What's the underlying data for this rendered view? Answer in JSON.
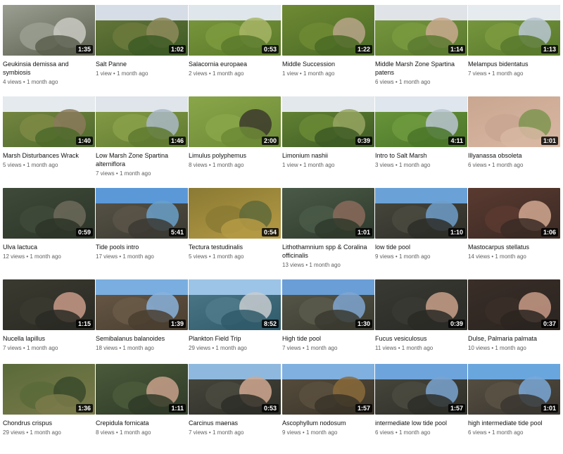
{
  "videos": [
    {
      "title": "Geukinsia demissa and symbiosis",
      "duration": "1:35",
      "views": "4 views",
      "age": "1 month ago",
      "colors": [
        "#9a9f92",
        "#c9c9c2",
        "#5b5f4e"
      ],
      "sky": null
    },
    {
      "title": "Salt Panne",
      "duration": "1:02",
      "views": "1 view",
      "age": "1 month ago",
      "colors": [
        "#6c7a3c",
        "#8d8a5c",
        "#3d5a26"
      ],
      "sky": "#d6dde6"
    },
    {
      "title": "Salacornia europaea",
      "duration": "0:53",
      "views": "2 views",
      "age": "1 month ago",
      "colors": [
        "#7d9a3e",
        "#a7b566",
        "#5b7a2b"
      ],
      "sky": "#dfe6ec"
    },
    {
      "title": "Middle Succession",
      "duration": "1:22",
      "views": "1 view",
      "age": "1 month ago",
      "colors": [
        "#6f8a34",
        "#b7a58a",
        "#4a6a25"
      ],
      "sky": null
    },
    {
      "title": "Middle Marsh Zone Spartina patens",
      "duration": "1:14",
      "views": "6 views",
      "age": "1 month ago",
      "colors": [
        "#7a9a3f",
        "#c9a98e",
        "#5b7a30"
      ],
      "sky": "#e0e4e9"
    },
    {
      "title": "Melampus bidentatus",
      "duration": "1:13",
      "views": "7 views",
      "age": "1 month ago",
      "colors": [
        "#7c9b40",
        "#b8c7d3",
        "#59792d"
      ],
      "sky": "#e6ebf0"
    },
    {
      "title": "Marsh Disturbances Wrack",
      "duration": "1:40",
      "views": "5 views",
      "age": "1 month ago",
      "colors": [
        "#7c8a44",
        "#8a7a5a",
        "#4e6a2c"
      ],
      "sky": "#e5eaee"
    },
    {
      "title": "Low Marsh Zone Spartina alterniflora",
      "duration": "1:46",
      "views": "7 views",
      "age": "1 month ago",
      "colors": [
        "#8aa04a",
        "#a9b8c5",
        "#5f7a30"
      ],
      "sky": "#dfe5ea"
    },
    {
      "title": "Limulus polyphemus",
      "duration": "2:00",
      "views": "8 views",
      "age": "1 month ago",
      "colors": [
        "#8aa64a",
        "#3c3a2c",
        "#6c8a36"
      ],
      "sky": null
    },
    {
      "title": "Limonium nashii",
      "duration": "0:39",
      "views": "1 view",
      "age": "1 month ago",
      "colors": [
        "#6a8a36",
        "#96a462",
        "#3d5a24"
      ],
      "sky": "#e3e8ec"
    },
    {
      "title": "Intro to Salt Marsh",
      "duration": "4:11",
      "views": "3 views",
      "age": "1 month ago",
      "colors": [
        "#6f9a3e",
        "#b8c4d0",
        "#4a7528"
      ],
      "sky": "#dfe6ed"
    },
    {
      "title": "Illyanassa obsoleta",
      "duration": "1:01",
      "views": "6 views",
      "age": "1 month ago",
      "colors": [
        "#c9a690",
        "#7e9550",
        "#d8b7a2"
      ],
      "sky": null
    },
    {
      "title": "Ulva lactuca",
      "duration": "0:59",
      "views": "12 views",
      "age": "1 month ago",
      "colors": [
        "#3f4a3a",
        "#6c6a5a",
        "#2c3528"
      ],
      "sky": null
    },
    {
      "title": "Tide pools intro",
      "duration": "5:41",
      "views": "17 views",
      "age": "1 month ago",
      "colors": [
        "#5a5548",
        "#6aa0c9",
        "#3b3a32"
      ],
      "sky": "#5b98d8"
    },
    {
      "title": "Tectura testudinalis",
      "duration": "0:54",
      "views": "5 views",
      "age": "1 month ago",
      "colors": [
        "#8a7a34",
        "#5f6a3a",
        "#b59a44"
      ],
      "sky": null
    },
    {
      "title": "Lithothamnium spp & Coralina officinalis",
      "duration": "1:01",
      "views": "13 views",
      "age": "1 month ago",
      "colors": [
        "#4a5a48",
        "#8a6a5a",
        "#2f3a2c"
      ],
      "sky": null
    },
    {
      "title": "low tide pool",
      "duration": "1:10",
      "views": "9 views",
      "age": "1 month ago",
      "colors": [
        "#4a4a40",
        "#6e9ec9",
        "#2e2e28"
      ],
      "sky": "#6aa2d8"
    },
    {
      "title": "Mastocarpus stellatus",
      "duration": "1:06",
      "views": "14 views",
      "age": "1 month ago",
      "colors": [
        "#5a3a30",
        "#d2a890",
        "#3a2a24"
      ],
      "sky": null
    },
    {
      "title": "Nucella lapillus",
      "duration": "1:15",
      "views": "7 views",
      "age": "1 month ago",
      "colors": [
        "#3a3a30",
        "#c89a88",
        "#2a2a24"
      ],
      "sky": null
    },
    {
      "title": "Semibalanus balanoides",
      "duration": "1:39",
      "views": "18 views",
      "age": "1 month ago",
      "colors": [
        "#6a5a48",
        "#8ab2dc",
        "#4a3e30"
      ],
      "sky": "#7aaee0"
    },
    {
      "title": "Plankton Field Trip",
      "duration": "8:52",
      "views": "29 views",
      "age": "1 month ago",
      "colors": [
        "#4f7a8a",
        "#c8ccd0",
        "#2f5a6a"
      ],
      "sky": "#9cc4e6"
    },
    {
      "title": "High tide pool",
      "duration": "1:30",
      "views": "7 views",
      "age": "1 month ago",
      "colors": [
        "#5a5a4c",
        "#7fa6d0",
        "#3a3a30"
      ],
      "sky": "#6a9ed6"
    },
    {
      "title": "Fucus vesiculosus",
      "duration": "0:39",
      "views": "11 views",
      "age": "1 month ago",
      "colors": [
        "#3a3a34",
        "#c8a08a",
        "#2a2a26"
      ],
      "sky": null
    },
    {
      "title": "Dulse, Palmaria palmata",
      "duration": "0:37",
      "views": "10 views",
      "age": "1 month ago",
      "colors": [
        "#3a2e28",
        "#c89a86",
        "#2a2420"
      ],
      "sky": null
    },
    {
      "title": "Chondrus crispus",
      "duration": "1:36",
      "views": "29 views",
      "age": "1 month ago",
      "colors": [
        "#5a6a3a",
        "#3a4a2c",
        "#7a7a4a"
      ],
      "sky": null
    },
    {
      "title": "Crepidula fornicata",
      "duration": "1:11",
      "views": "8 views",
      "age": "1 month ago",
      "colors": [
        "#4a5a3a",
        "#c8a08a",
        "#2f3a28"
      ],
      "sky": null
    },
    {
      "title": "Carcinus maenas",
      "duration": "0:53",
      "views": "7 views",
      "age": "1 month ago",
      "colors": [
        "#4a4a40",
        "#d0a890",
        "#2e2e28"
      ],
      "sky": "#8fb8de"
    },
    {
      "title": "Ascophyllum nodosum",
      "duration": "1:57",
      "views": "9 views",
      "age": "1 month ago",
      "colors": [
        "#5a5040",
        "#8a6a3a",
        "#3a3428"
      ],
      "sky": "#7fb0e0"
    },
    {
      "title": "intermediate low tide pool",
      "duration": "1:57",
      "views": "6 views",
      "age": "1 month ago",
      "colors": [
        "#4a4a40",
        "#7aa4d0",
        "#2e2e28"
      ],
      "sky": "#6ea4dc"
    },
    {
      "title": "high intermediate tide pool",
      "duration": "1:01",
      "views": "6 views",
      "age": "1 month ago",
      "colors": [
        "#5a5244",
        "#7aa8d8",
        "#3a3630"
      ],
      "sky": "#6aa6de"
    }
  ]
}
